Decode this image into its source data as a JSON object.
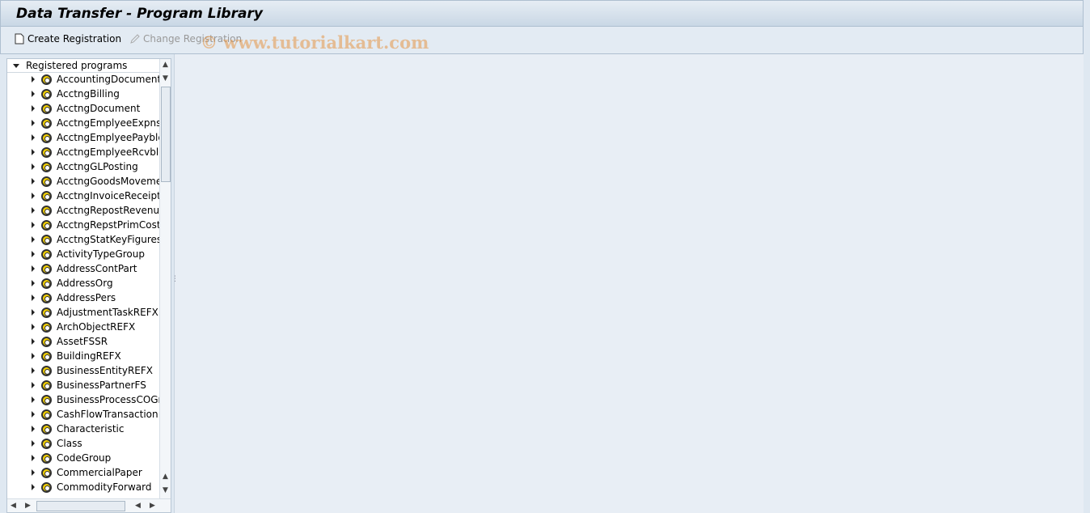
{
  "window": {
    "title": "Data Transfer - Program Library"
  },
  "toolbar": {
    "create_label": "Create Registration",
    "change_label": "Change Registration"
  },
  "watermark": "© www.tutorialkart.com",
  "tree": {
    "root": "Registered programs",
    "items": [
      "AccountingDocument",
      "AcctngBilling",
      "AcctngDocument",
      "AcctngEmplyeeExpnses",
      "AcctngEmplyeePaybles",
      "AcctngEmplyeeRcvbles",
      "AcctngGLPosting",
      "AcctngGoodsMovement",
      "AcctngInvoiceReceipt",
      "AcctngRepostRevenue",
      "AcctngRepstPrimCosts",
      "AcctngStatKeyFigures",
      "ActivityTypeGroup",
      "AddressContPart",
      "AddressOrg",
      "AddressPers",
      "AdjustmentTaskREFX",
      "ArchObjectREFX",
      "AssetFSSR",
      "BuildingREFX",
      "BusinessEntityREFX",
      "BusinessPartnerFS",
      "BusinessProcessCOGrp",
      "CashFlowTransaction",
      "Characteristic",
      "Class",
      "CodeGroup",
      "CommercialPaper",
      "CommodityForward"
    ]
  }
}
